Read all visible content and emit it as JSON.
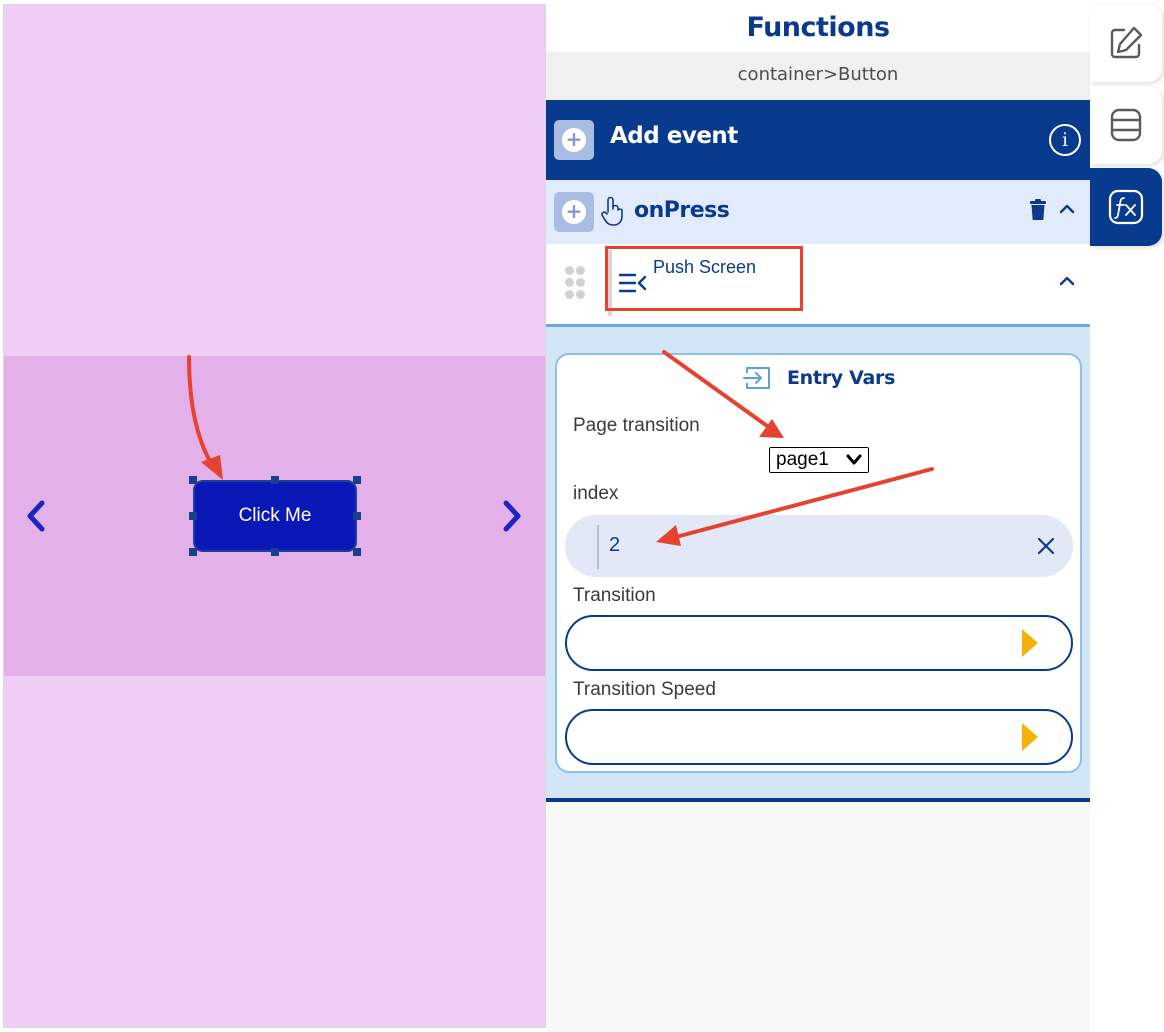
{
  "canvas": {
    "button_label": "Click Me",
    "colors": {
      "background": "#efcdf4",
      "carousel": "#e3b0ea",
      "button": "#0a18b7",
      "arrows": "#1a25c2"
    },
    "icons": {
      "prev": "chevron-left-icon",
      "next": "chevron-right-icon"
    }
  },
  "panel": {
    "title": "Functions",
    "breadcrumb": "container>Button",
    "add_event": {
      "label": "Add event",
      "icons": [
        "add-icon",
        "info-icon"
      ]
    },
    "event": {
      "label": "onPress",
      "icons": [
        "add-icon",
        "touch-icon",
        "trash-icon",
        "chevron-up-icon"
      ]
    },
    "action": {
      "label": "Push Screen",
      "icons": [
        "drag-handle-icon",
        "push-screen-icon",
        "chevron-up-icon"
      ]
    },
    "entry_vars": {
      "title": "Entry Vars",
      "page_transition": {
        "label": "Page transition",
        "value": "page1"
      },
      "index": {
        "label": "index",
        "value": "2"
      },
      "transition": {
        "label": "Transition",
        "value": ""
      },
      "transition_speed": {
        "label": "Transition Speed",
        "value": ""
      }
    },
    "colors": {
      "primary": "#083a8e",
      "accent": "#f5b10a",
      "annotation": "#e5432f"
    }
  },
  "rail": {
    "tabs": [
      {
        "name": "edit-icon",
        "active": false
      },
      {
        "name": "database-icon",
        "active": false
      },
      {
        "name": "function-icon",
        "active": true
      }
    ]
  }
}
